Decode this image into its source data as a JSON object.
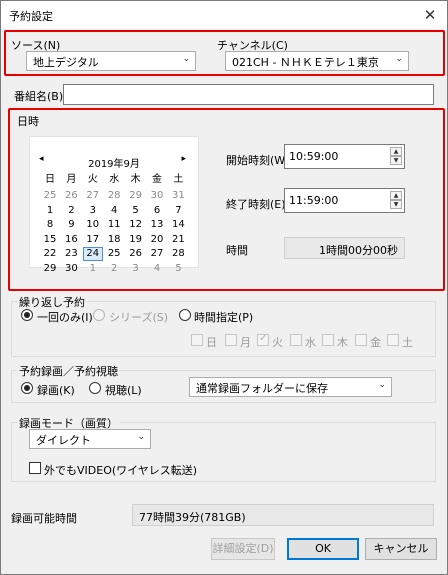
{
  "window": {
    "title": "予約設定",
    "close_glyph": "✕"
  },
  "source": {
    "label": "ソース(N)",
    "value": "地上デジタル"
  },
  "channel": {
    "label": "チャンネル(C)",
    "value": "021CH - ＮＨＫＥテレ１東京"
  },
  "program_name": {
    "label": "番組名(B)",
    "value": ""
  },
  "datetime": {
    "group_label": "日時",
    "calendar": {
      "month_title": "2019年9月",
      "prev_glyph": "◂",
      "next_glyph": "▸",
      "weekdays": [
        "日",
        "月",
        "火",
        "水",
        "木",
        "金",
        "土"
      ],
      "weeks": [
        [
          "25",
          "26",
          "27",
          "28",
          "29",
          "30",
          "31"
        ],
        [
          "1",
          "2",
          "3",
          "4",
          "5",
          "6",
          "7"
        ],
        [
          "8",
          "9",
          "10",
          "11",
          "12",
          "13",
          "14"
        ],
        [
          "15",
          "16",
          "17",
          "18",
          "19",
          "20",
          "21"
        ],
        [
          "22",
          "23",
          "24",
          "25",
          "26",
          "27",
          "28"
        ],
        [
          "29",
          "30",
          "1",
          "2",
          "3",
          "4",
          "5"
        ]
      ],
      "selected": "24"
    },
    "start_label": "開始時刻(W)",
    "start_value": "10:59:00",
    "end_label": "終了時刻(E)",
    "end_value": "11:59:00",
    "duration_label": "時間",
    "duration_value": "1時間00分00秒"
  },
  "repeat": {
    "group_label": "繰り返し予約",
    "once": "一回のみ(I)",
    "series": "シリーズ(S)",
    "time_spec": "時間指定(P)",
    "days": [
      "日",
      "月",
      "火",
      "水",
      "木",
      "金",
      "土"
    ]
  },
  "record_mode_group": {
    "group_label": "予約録画／予約視聴",
    "record": "録画(K)",
    "watch": "視聴(L)",
    "folder": "通常録画フォルダーに保存"
  },
  "quality": {
    "group_label": "録画モード（画質）",
    "value": "ダイレクト",
    "outside_video": "外でもVIDEO(ワイヤレス転送)"
  },
  "available": {
    "label": "録画可能時間",
    "value": "77時間39分(781GB)"
  },
  "buttons": {
    "details": "詳細設定(D)",
    "ok": "OK",
    "cancel": "キャンセル"
  }
}
